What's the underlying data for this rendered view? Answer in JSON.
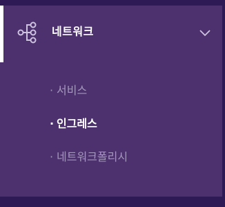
{
  "nav": {
    "title": "네트워크",
    "icon": "network-topology-icon",
    "chevron_icon": "chevron-down-icon",
    "bullet": "·",
    "active_index": 1,
    "items": [
      {
        "label": "서비스",
        "active": false
      },
      {
        "label": "인그레스",
        "active": true
      },
      {
        "label": "네트워크폴리시",
        "active": false
      }
    ]
  },
  "colors": {
    "page_background": "#2e1b56",
    "panel_background": "#4d316f",
    "active_indicator": "#ffffff",
    "active_text": "#ffffff",
    "inactive_text": "#a597bc",
    "icon_stroke": "#cdc3df"
  }
}
